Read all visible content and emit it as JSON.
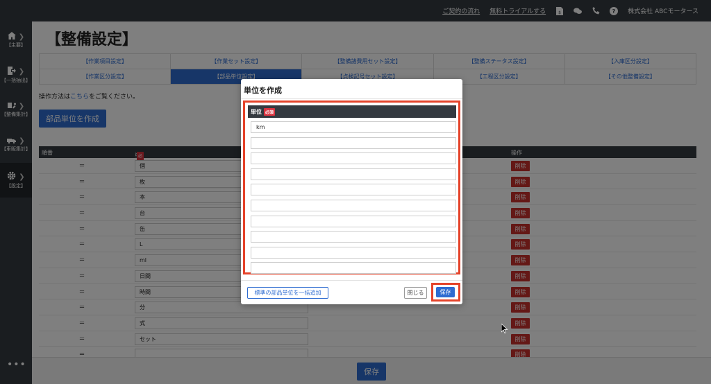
{
  "topbar": {
    "contract_flow": "ご契約の流れ",
    "free_trial": "無料トライアルする",
    "company": "株式会社 ABCモータース",
    "icons": [
      "document-yen-icon",
      "chat-icon",
      "phone-icon",
      "help-icon"
    ]
  },
  "sidebar": {
    "items": [
      {
        "label": "【主要】",
        "icon": "home-icon"
      },
      {
        "label": "【一括抽出】",
        "icon": "export-icon"
      },
      {
        "label": "【整備集計】",
        "icon": "wrench-icon"
      },
      {
        "label": "【車販集計】",
        "icon": "car-icon"
      },
      {
        "label": "【設定】",
        "icon": "gear-icon"
      }
    ],
    "more": "•••"
  },
  "page": {
    "title": "【整備設定】",
    "tabs": [
      "【作業項目設定】",
      "【作業セット設定】",
      "【整備諸費用セット設定】",
      "【整備ステータス設定】",
      "【入庫区分設定】",
      "【作業区分設定】",
      "【部品単位設定】",
      "【点検記号セット設定】",
      "【工程区分設定】",
      "【その他整備設定】"
    ],
    "howto_prefix": "操作方法は",
    "howto_link": "こちら",
    "howto_suffix": "をご覧ください。",
    "create_button": "部品単位を作成"
  },
  "table": {
    "headers": {
      "order": "順番",
      "unit": "単位",
      "required": "必須",
      "action": "操作"
    },
    "handle": "═",
    "delete_label": "削除",
    "rows": [
      "個",
      "枚",
      "本",
      "台",
      "缶",
      "L",
      "ml",
      "日間",
      "時間",
      "分",
      "式",
      "セット",
      ""
    ]
  },
  "bottom": {
    "save_label": "保存"
  },
  "modal": {
    "title": "単位を作成",
    "unit_header": "単位",
    "required": "必須",
    "fields": [
      "km",
      "",
      "",
      "",
      "",
      "",
      "",
      "",
      "",
      ""
    ],
    "bulk_add": "標準の部品単位を一括追加",
    "close": "閉じる",
    "save": "保存"
  },
  "colors": {
    "accent": "#2e6cd1",
    "danger": "#c9302c",
    "dark": "#343a40",
    "highlight": "#e5432a"
  }
}
